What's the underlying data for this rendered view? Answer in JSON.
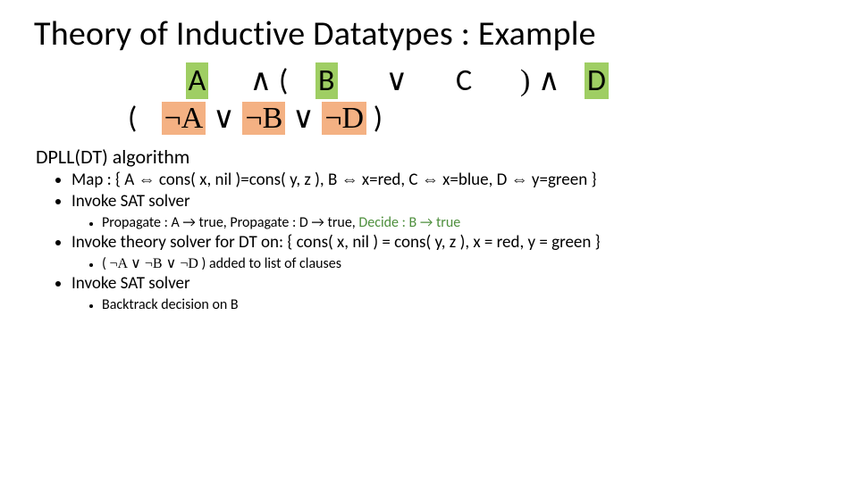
{
  "title": "Theory of Inductive Datatypes : Example",
  "formula": {
    "A": "A",
    "and1": "∧",
    "lpar1": "(",
    "B": "B",
    "or1": "∨",
    "C": "C",
    "rpar_and": ") ∧",
    "D": "D",
    "l2_open": "(",
    "l2_notA": "¬A",
    "l2_or1": " ∨ ",
    "l2_notB": "¬B",
    "l2_or2": " ∨ ",
    "l2_notD": "¬D",
    "l2_close": " )"
  },
  "section": "DPLL(DT) algorithm",
  "bul": {
    "map": "Map :  { A ⇔ cons( x, nil )=cons( y, z ), B ⇔ x=red, C ⇔ x=blue, D ⇔ y=green }",
    "sat1": "Invoke SAT solver",
    "prop_a": "Propagate : A → true,",
    "prop_d": " Propagate : D → true,  ",
    "decide_b": "Decide : B → true",
    "theory": "Invoke theory solver for DT on: { cons( x, nil ) = cons( y, z ), x = red, y = green }",
    "clause_open": "( ",
    "clause_nA": "¬A",
    "clause_mid1": " ∨ ",
    "clause_nB": "¬B",
    "clause_mid2": " ∨ ",
    "clause_nD": "¬D",
    "clause_close": " ) added to list of clauses",
    "sat2": "Invoke SAT solver",
    "backtrack": "Backtrack decision on B"
  }
}
